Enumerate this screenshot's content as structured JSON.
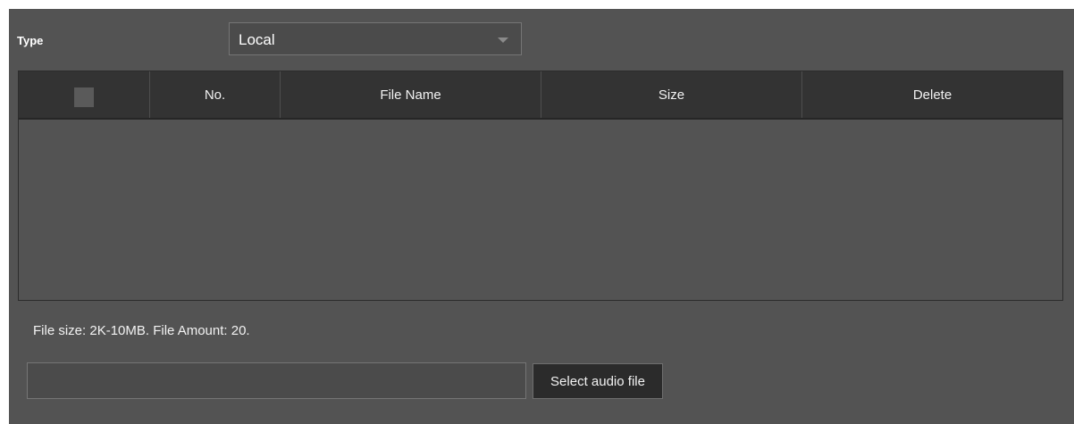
{
  "type_field": {
    "label": "Type",
    "selected": "Local"
  },
  "file_table": {
    "columns": [
      "No.",
      "File Name",
      "Size",
      "Delete"
    ],
    "rows": []
  },
  "hint_text": "File size: 2K-10MB. File Amount: 20.",
  "upload": {
    "path_value": "",
    "select_label": "Select audio file"
  },
  "colors": {
    "panel_bg": "#535353",
    "header_bg": "#333333",
    "button_bg": "#2b2b2b",
    "text": "#f2f2f2"
  }
}
